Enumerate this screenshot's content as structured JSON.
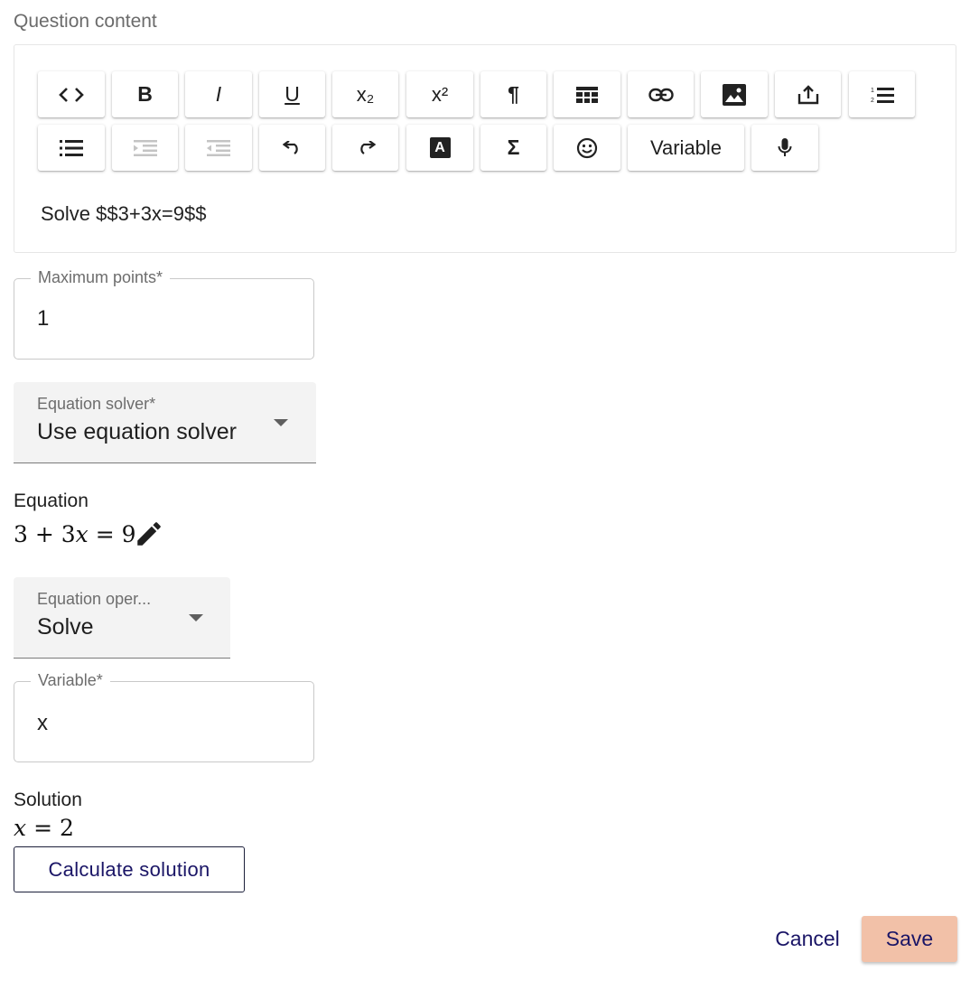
{
  "question": {
    "section_label": "Question content",
    "content": "Solve $$3+3x=9$$"
  },
  "toolbar": {
    "row1": [
      {
        "name": "code-icon",
        "kind": "icon"
      },
      {
        "name": "bold-icon",
        "kind": "icon"
      },
      {
        "name": "italic-icon",
        "kind": "icon"
      },
      {
        "name": "underline-icon",
        "kind": "icon"
      },
      {
        "name": "subscript-icon",
        "kind": "icon"
      },
      {
        "name": "superscript-icon",
        "kind": "icon"
      },
      {
        "name": "paragraph-icon",
        "kind": "icon"
      },
      {
        "name": "table-icon",
        "kind": "icon"
      },
      {
        "name": "link-icon",
        "kind": "icon"
      },
      {
        "name": "image-icon",
        "kind": "icon"
      },
      {
        "name": "upload-icon",
        "kind": "icon"
      },
      {
        "name": "numbered-list-icon",
        "kind": "icon"
      }
    ],
    "row2": [
      {
        "name": "bulleted-list-icon",
        "kind": "icon"
      },
      {
        "name": "indent-icon",
        "kind": "icon",
        "disabled": true
      },
      {
        "name": "outdent-icon",
        "kind": "icon",
        "disabled": true
      },
      {
        "name": "undo-icon",
        "kind": "icon"
      },
      {
        "name": "redo-icon",
        "kind": "icon"
      },
      {
        "name": "text-color-icon",
        "kind": "icon"
      },
      {
        "name": "sigma-icon",
        "kind": "icon"
      },
      {
        "name": "emoji-icon",
        "kind": "icon"
      },
      {
        "name": "variable-button",
        "kind": "text"
      },
      {
        "name": "microphone-icon",
        "kind": "icon"
      }
    ],
    "bold_glyph": "B",
    "italic_glyph": "I",
    "underline_glyph": "U",
    "subscript_glyph": "x₂",
    "superscript_glyph": "x²",
    "paragraph_glyph": "¶",
    "sigma_glyph": "Σ",
    "text_color_glyph": "A",
    "variable_label": "Variable"
  },
  "max_points": {
    "label": "Maximum points*",
    "value": "1"
  },
  "equation_solver": {
    "label": "Equation solver*",
    "value": "Use equation solver"
  },
  "equation": {
    "heading": "Equation",
    "lhs_a": "3",
    "plus": "+",
    "lhs_b": "3",
    "var": "x",
    "equals": "=",
    "rhs": "9"
  },
  "equation_operation": {
    "label": "Equation oper...",
    "value": "Solve"
  },
  "variable": {
    "label": "Variable*",
    "value": "x"
  },
  "solution": {
    "heading": "Solution",
    "var": "x",
    "equals": "=",
    "value": "2"
  },
  "actions": {
    "calculate_label": "Calculate solution",
    "cancel_label": "Cancel",
    "save_label": "Save"
  },
  "colors": {
    "primary_text": "#1a1566",
    "save_bg": "#f2c1a8"
  }
}
